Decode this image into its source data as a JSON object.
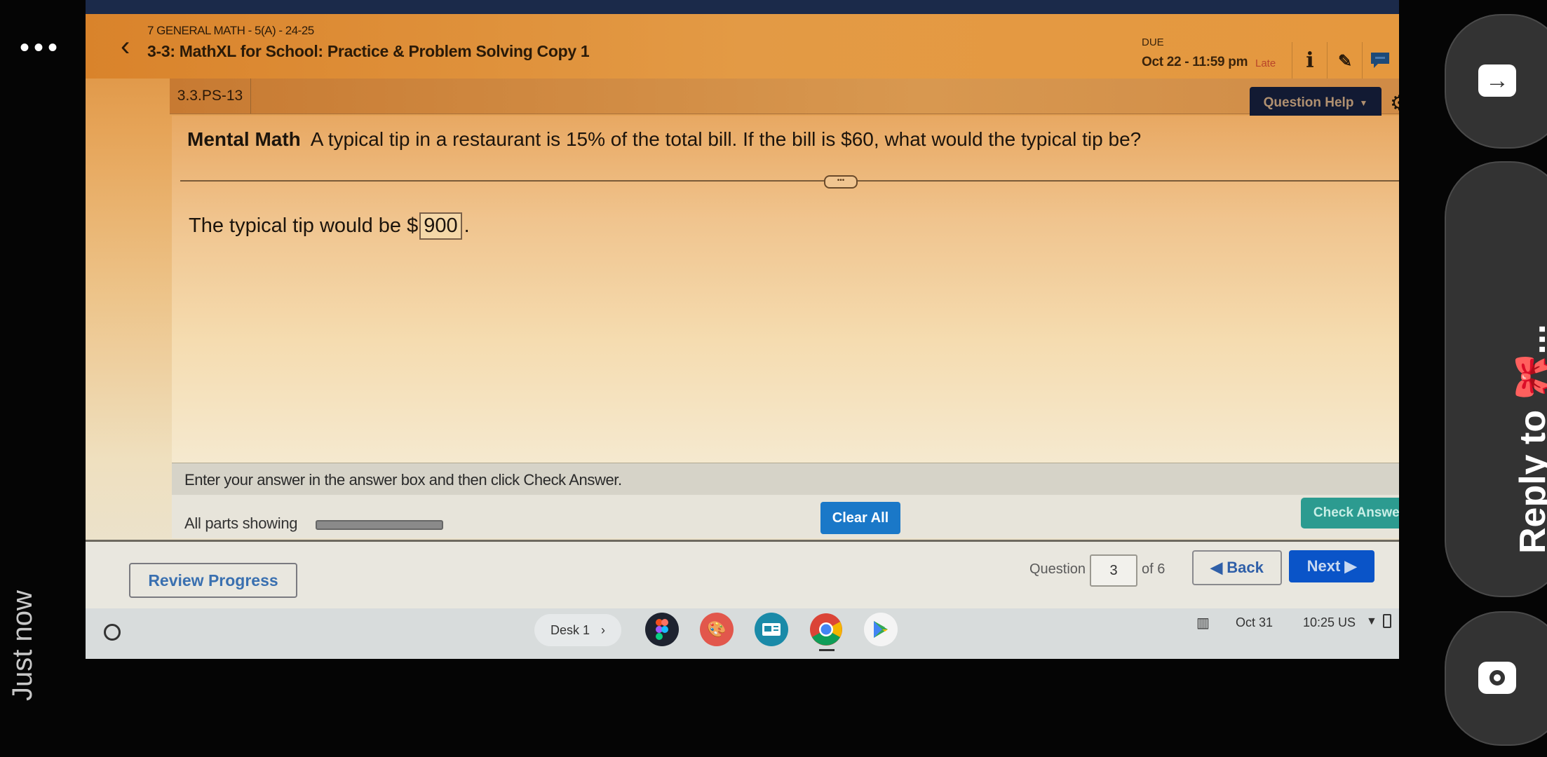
{
  "header": {
    "course": "7 GENERAL MATH - 5(A) - 24-25",
    "assignment": "3-3: MathXL for School: Practice & Problem Solving Copy 1",
    "due_label": "DUE",
    "due_value": "Oct 22 - 11:59 pm",
    "late_badge": "Late",
    "icons": [
      "back-chevron-icon",
      "info-icon",
      "pencil-icon",
      "message-icon"
    ]
  },
  "problem": {
    "id": "3.3.PS-13",
    "question_help": "Question Help",
    "prefix": "Mental Math",
    "question": "A typical tip in a restaurant is 15% of the total bill. If the bill is $60, what would the typical tip be?",
    "more_button": "•••",
    "answer_before": "The typical tip would be $",
    "answer_value": "900",
    "answer_after": "."
  },
  "instruction": "Enter your answer in the answer box and then click Check Answer.",
  "parts": {
    "label": "All parts showing",
    "clear_all": "Clear All",
    "check_answer": "Check Answer"
  },
  "footer": {
    "review_progress": "Review Progress",
    "question_label": "Question",
    "question_number": "3",
    "question_of": "of 6",
    "back": "◀ Back",
    "next": "Next ▶"
  },
  "shelf": {
    "desk": "Desk 1",
    "desk_arrow": "›",
    "apps": [
      "figma",
      "canvas",
      "classroom",
      "chrome",
      "play-store"
    ],
    "date": "Oct 31",
    "time": "10:25 US",
    "status_icons": [
      "wifi-icon",
      "battery-icon"
    ]
  },
  "overlay": {
    "more_dots": "•••",
    "timestamp": "Just now",
    "reply_text": "Reply to 🎀...",
    "share_icon": "share-arrow-icon",
    "camera_icon": "camera-icon"
  },
  "colors": {
    "header": "#e09440",
    "check_answer": "#2c9b90",
    "clear_all": "#1a78c8",
    "next": "#0a54c8",
    "late": "#b8442a"
  }
}
